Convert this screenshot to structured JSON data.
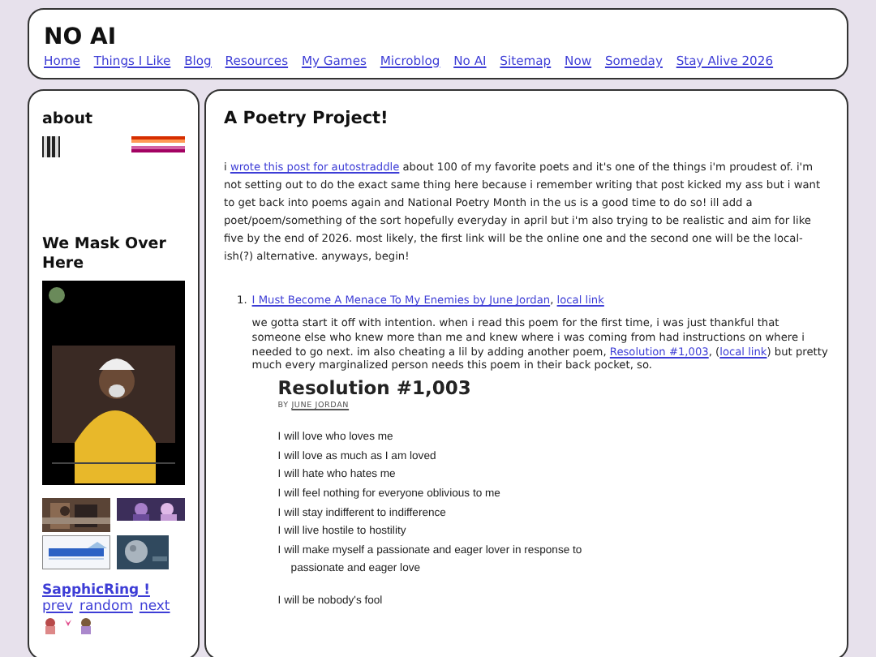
{
  "header": {
    "title": "NO AI",
    "nav": [
      {
        "label": "Home"
      },
      {
        "label": "Things I Like"
      },
      {
        "label": "Blog"
      },
      {
        "label": "Resources"
      },
      {
        "label": "My Games"
      },
      {
        "label": "Microblog"
      },
      {
        "label": "No AI"
      },
      {
        "label": "Sitemap"
      },
      {
        "label": "Now"
      },
      {
        "label": "Someday"
      },
      {
        "label": "Stay Alive 2026"
      }
    ]
  },
  "sidebar": {
    "about_heading": "about",
    "mask_heading": "We Mask Over Here",
    "webring": {
      "title": "SapphicRing !",
      "links": [
        "prev",
        "random",
        "next"
      ]
    }
  },
  "post": {
    "title": "A Poetry Project!",
    "intro": [
      {
        "kind": "text",
        "text": "i "
      },
      {
        "kind": "link",
        "text": "wrote this post for autostraddle"
      },
      {
        "kind": "text",
        "text": " about 100 of my favorite poets and it's one of the things i'm proudest of. i'm not setting out to do the exact same thing here because i remember writing that post kicked my ass but i want to get back into poems again and National Poetry Month in the us is a good time to do so! ill add a poet/poem/something of the sort hopefully everyday in april but i'm also trying to be realistic and aim for like five by the end of 2026. most likely, the first link will be the online one and the second one will be the local-ish(?) alternative. anyways, begin!"
      }
    ],
    "entries": [
      {
        "number": "1.",
        "links": [
          "I Must Become A Menace To My Enemies by June Jordan",
          "local link"
        ],
        "separator": ",",
        "note": [
          {
            "kind": "text",
            "text": "we gotta start it off with intention. when i read this poem for the first time, i was just thankful that someone else who knew more than me and knew where i was coming from had instructions on where i needed to go next. im also cheating a lil by adding another poem, "
          },
          {
            "kind": "link",
            "text": "Resolution #1,003"
          },
          {
            "kind": "text",
            "text": ", ("
          },
          {
            "kind": "link",
            "text": "local link"
          },
          {
            "kind": "text",
            "text": ") but pretty much every marginalized person needs this poem in their back pocket, so."
          }
        ],
        "poem": {
          "title": "Resolution #1,003",
          "by": "BY",
          "author": "JUNE JORDAN",
          "stanzas": [
            [
              {
                "text": "I will love who loves me",
                "indent": false
              },
              {
                "text": "I will love as much as I am loved",
                "indent": false
              },
              {
                "text": "I will hate who hates me",
                "indent": false
              },
              {
                "text": "I will feel nothing for everyone oblivious to me",
                "indent": false
              },
              {
                "text": "I will stay indifferent to indifference",
                "indent": false
              },
              {
                "text": "I will live hostile to hostility",
                "indent": false
              },
              {
                "text": "I will make myself a passionate and eager lover in response to",
                "indent": false
              },
              {
                "text": "passionate and eager love",
                "indent": true
              }
            ],
            [
              {
                "text": "I will be nobody's fool",
                "indent": false
              }
            ]
          ]
        }
      }
    ]
  }
}
